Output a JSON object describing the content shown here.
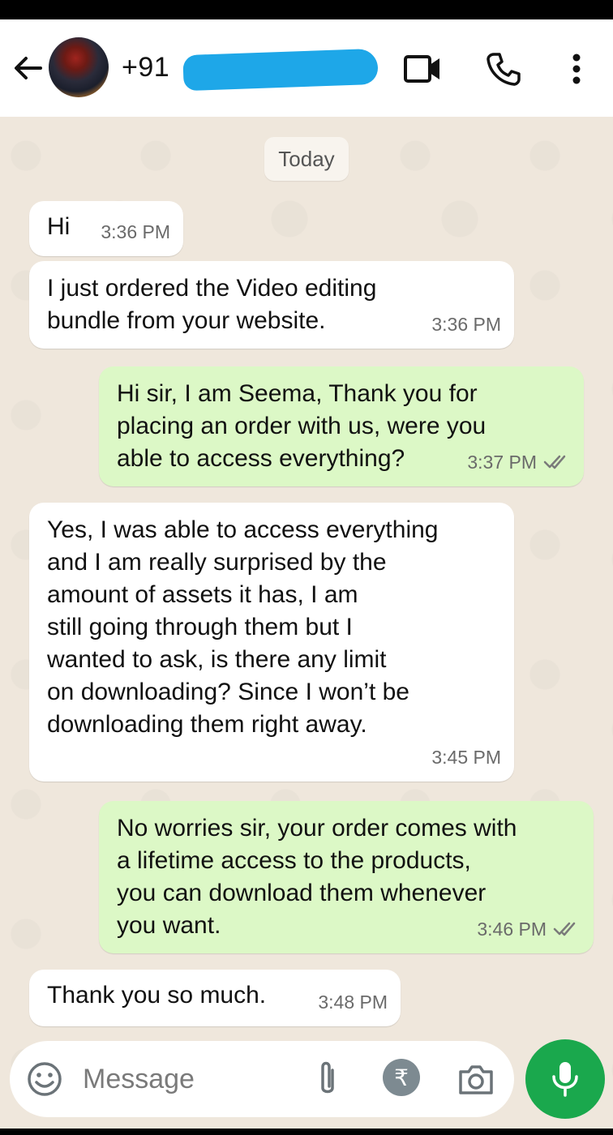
{
  "header": {
    "contact_name": "+91",
    "colors": {
      "background": "#ffffff",
      "redaction": "#1ea7e8"
    },
    "icons": [
      "back-arrow-icon",
      "video-camera-icon",
      "phone-icon",
      "more-vert-icon"
    ]
  },
  "date_chip": "Today",
  "messages": [
    {
      "direction": "incoming",
      "text": "Hi",
      "time": "3:36 PM"
    },
    {
      "direction": "incoming",
      "text": "I just ordered the Video editing\nbundle from your website.",
      "time": "3:36 PM"
    },
    {
      "direction": "outgoing",
      "text": "Hi sir, I am Seema, Thank you for\nplacing an order with us, were you\nable to access everything?",
      "time": "3:37 PM",
      "status": "read"
    },
    {
      "direction": "incoming",
      "text": "Yes, I was able to access everything\nand I am really surprised by the\namount of assets it has, I am\nstill going through them but I\nwanted to ask, is there any limit\non downloading? Since I won’t be\ndownloading them right away.",
      "time": "3:45 PM"
    },
    {
      "direction": "outgoing",
      "text": "No worries sir, your order comes with\na lifetime access to the products,\nyou can download them whenever\nyou want.",
      "time": "3:46 PM",
      "status": "read"
    },
    {
      "direction": "incoming",
      "text": "Thank you so much.",
      "time": "3:48 PM"
    }
  ],
  "composer": {
    "placeholder": "Message",
    "rupee_symbol": "₹",
    "icons": [
      "emoji-icon",
      "attach-icon",
      "rupee-icon",
      "camera-icon",
      "mic-icon"
    ]
  },
  "colors": {
    "chat_background": "#efe7dc",
    "incoming_bubble": "#ffffff",
    "outgoing_bubble": "#dcf8c6",
    "accent_green": "#1aa84d"
  }
}
